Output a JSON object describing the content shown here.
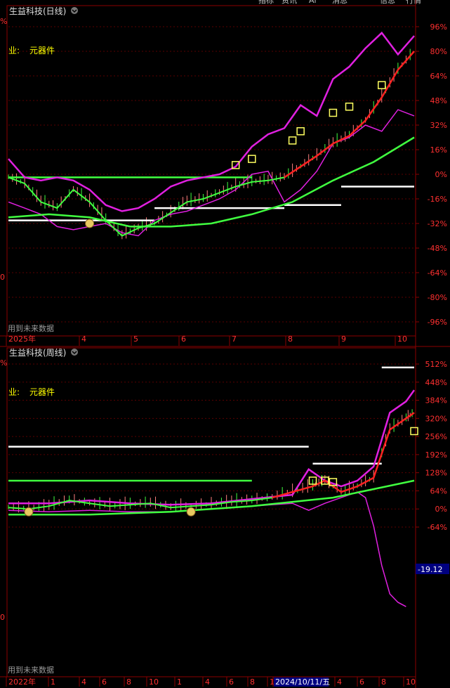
{
  "chart_data": [
    {
      "type": "line",
      "title": "生益科技(日线)",
      "industry_label": "业:",
      "industry_value": "元器件",
      "footer_note": "用到未来数据",
      "top_tabs": [
        "指标",
        "资讯",
        "Ai",
        "消息",
        "信息",
        "行情"
      ],
      "yaxis_ticks": [
        "96%",
        "80%",
        "64%",
        "48%",
        "32%",
        "16%",
        "0%",
        "-16%",
        "-32%",
        "-48%",
        "-64%",
        "-80%",
        "-96%"
      ],
      "ylim": [
        -104,
        104
      ],
      "xaxis_labels": [
        "2025年",
        "4",
        "5",
        "6",
        "7",
        "8",
        "9",
        "10"
      ],
      "left_edge_labels": [
        "%",
        "0"
      ],
      "price_curve": [
        [
          0,
          -2
        ],
        [
          4,
          -6
        ],
        [
          8,
          -18
        ],
        [
          12,
          -22
        ],
        [
          16,
          -10
        ],
        [
          20,
          -18
        ],
        [
          24,
          -30
        ],
        [
          28,
          -40
        ],
        [
          32,
          -35
        ],
        [
          36,
          -32
        ],
        [
          40,
          -25
        ],
        [
          44,
          -18
        ],
        [
          48,
          -16
        ],
        [
          52,
          -12
        ],
        [
          56,
          -8
        ],
        [
          60,
          -5
        ],
        [
          64,
          -4
        ],
        [
          68,
          -2
        ],
        [
          72,
          5
        ],
        [
          76,
          12
        ],
        [
          80,
          20
        ],
        [
          84,
          25
        ],
        [
          88,
          35
        ],
        [
          92,
          50
        ],
        [
          96,
          68
        ],
        [
          100,
          80
        ]
      ],
      "upper_band": [
        [
          0,
          10
        ],
        [
          4,
          -2
        ],
        [
          8,
          -4
        ],
        [
          12,
          -2
        ],
        [
          16,
          -4
        ],
        [
          20,
          -10
        ],
        [
          24,
          -20
        ],
        [
          28,
          -24
        ],
        [
          32,
          -22
        ],
        [
          36,
          -16
        ],
        [
          40,
          -8
        ],
        [
          44,
          -4
        ],
        [
          48,
          -2
        ],
        [
          52,
          0
        ],
        [
          56,
          5
        ],
        [
          60,
          18
        ],
        [
          64,
          26
        ],
        [
          68,
          30
        ],
        [
          72,
          45
        ],
        [
          76,
          38
        ],
        [
          80,
          62
        ],
        [
          84,
          70
        ],
        [
          88,
          82
        ],
        [
          92,
          92
        ],
        [
          96,
          78
        ],
        [
          100,
          90
        ]
      ],
      "lower_band": [
        [
          0,
          -18
        ],
        [
          4,
          -22
        ],
        [
          8,
          -26
        ],
        [
          12,
          -34
        ],
        [
          16,
          -36
        ],
        [
          20,
          -34
        ],
        [
          24,
          -32
        ],
        [
          28,
          -38
        ],
        [
          32,
          -40
        ],
        [
          36,
          -30
        ],
        [
          40,
          -26
        ],
        [
          44,
          -24
        ],
        [
          48,
          -20
        ],
        [
          52,
          -16
        ],
        [
          56,
          -10
        ],
        [
          60,
          0
        ],
        [
          64,
          2
        ],
        [
          68,
          -18
        ],
        [
          72,
          -10
        ],
        [
          76,
          2
        ],
        [
          80,
          20
        ],
        [
          84,
          24
        ],
        [
          88,
          32
        ],
        [
          92,
          28
        ],
        [
          96,
          42
        ],
        [
          100,
          38
        ]
      ],
      "long_ma": [
        [
          0,
          -28
        ],
        [
          10,
          -26
        ],
        [
          20,
          -28
        ],
        [
          30,
          -34
        ],
        [
          40,
          -34
        ],
        [
          50,
          -32
        ],
        [
          60,
          -26
        ],
        [
          70,
          -18
        ],
        [
          80,
          -4
        ],
        [
          90,
          8
        ],
        [
          100,
          24
        ]
      ],
      "levels": [
        [
          0,
          36,
          -30
        ],
        [
          36,
          68,
          -22
        ],
        [
          68,
          82,
          -20
        ],
        [
          82,
          100,
          -8
        ]
      ],
      "green_level": -2,
      "rise_markers": [
        [
          56,
          6
        ],
        [
          60,
          10
        ],
        [
          70,
          22
        ],
        [
          72,
          28
        ],
        [
          80,
          40
        ],
        [
          84,
          44
        ],
        [
          92,
          58
        ]
      ],
      "money_markers": [
        [
          20,
          -32
        ]
      ]
    },
    {
      "type": "line",
      "title": "生益科技(周线)",
      "industry_label": "业:",
      "industry_value": "元器件",
      "footer_note": "用到未来数据",
      "yaxis_ticks": [
        "512%",
        "448%",
        "384%",
        "320%",
        "256%",
        "192%",
        "128%",
        "64%",
        "0%",
        "-64%"
      ],
      "ylim": [
        -360,
        540
      ],
      "current_value": "-19.12",
      "xaxis_labels": [
        "2022年",
        "1",
        "4",
        "6",
        "8",
        "10",
        "1",
        "4",
        "6",
        "8",
        "10",
        "2024/10/11/五",
        "4",
        "6",
        "8",
        "10"
      ],
      "left_edge_labels": [
        "%",
        "0"
      ],
      "price_curve": [
        [
          0,
          5
        ],
        [
          5,
          0
        ],
        [
          10,
          10
        ],
        [
          15,
          30
        ],
        [
          20,
          20
        ],
        [
          25,
          10
        ],
        [
          30,
          15
        ],
        [
          35,
          20
        ],
        [
          40,
          5
        ],
        [
          45,
          10
        ],
        [
          50,
          15
        ],
        [
          55,
          25
        ],
        [
          60,
          30
        ],
        [
          65,
          40
        ],
        [
          70,
          60
        ],
        [
          75,
          80
        ],
        [
          78,
          100
        ],
        [
          82,
          60
        ],
        [
          86,
          80
        ],
        [
          90,
          110
        ],
        [
          94,
          280
        ],
        [
          98,
          320
        ],
        [
          100,
          340
        ]
      ],
      "upper_band": [
        [
          0,
          20
        ],
        [
          10,
          20
        ],
        [
          20,
          30
        ],
        [
          30,
          20
        ],
        [
          40,
          15
        ],
        [
          50,
          20
        ],
        [
          60,
          35
        ],
        [
          70,
          50
        ],
        [
          74,
          140
        ],
        [
          78,
          100
        ],
        [
          82,
          80
        ],
        [
          86,
          100
        ],
        [
          90,
          150
        ],
        [
          94,
          340
        ],
        [
          98,
          380
        ],
        [
          100,
          420
        ]
      ],
      "lower_band": [
        [
          0,
          -5
        ],
        [
          10,
          -10
        ],
        [
          20,
          -5
        ],
        [
          30,
          -10
        ],
        [
          40,
          -10
        ],
        [
          50,
          0
        ],
        [
          60,
          10
        ],
        [
          70,
          20
        ],
        [
          74,
          -5
        ],
        [
          78,
          20
        ],
        [
          82,
          40
        ],
        [
          86,
          60
        ],
        [
          88,
          40
        ],
        [
          90,
          -60
        ],
        [
          92,
          -200
        ],
        [
          94,
          -300
        ],
        [
          96,
          -330
        ],
        [
          98,
          -345
        ]
      ],
      "long_ma": [
        [
          0,
          -20
        ],
        [
          20,
          -20
        ],
        [
          40,
          -10
        ],
        [
          60,
          10
        ],
        [
          80,
          40
        ],
        [
          90,
          70
        ],
        [
          100,
          100
        ]
      ],
      "levels": [
        [
          0,
          74,
          220
        ],
        [
          75,
          92,
          160
        ],
        [
          92,
          100,
          500
        ]
      ],
      "green_level": 100,
      "rise_markers": [
        [
          75,
          100
        ],
        [
          78,
          100
        ],
        [
          80,
          95
        ],
        [
          100,
          275
        ]
      ],
      "money_markers": [
        [
          5,
          -10
        ],
        [
          45,
          -10
        ]
      ]
    }
  ]
}
